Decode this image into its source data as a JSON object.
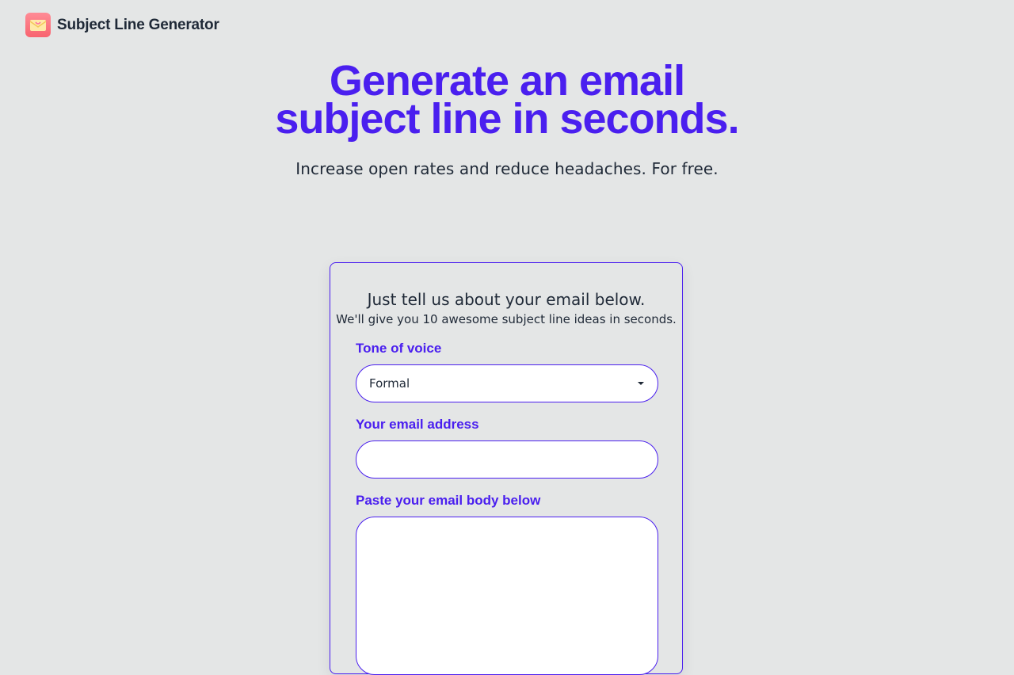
{
  "header": {
    "logo_icon": "envelope-icon",
    "brand_name": "Subject Line Generator"
  },
  "hero": {
    "title_line1": "Generate an email",
    "title_line2": "subject line in seconds.",
    "subtitle": "Increase open rates and reduce headaches. For free."
  },
  "form": {
    "heading": "Just tell us about your email below.",
    "subheading": "We'll give you 10 awesome subject line ideas in seconds.",
    "tone": {
      "label": "Tone of voice",
      "selected": "Formal",
      "caret_icon": "caret-down-icon"
    },
    "email": {
      "label": "Your email address",
      "value": "",
      "placeholder": ""
    },
    "body": {
      "label": "Paste your email body below",
      "value": "",
      "placeholder": ""
    }
  },
  "colors": {
    "accent": "#4a1fef",
    "background": "#e4e6e6",
    "text": "#1f2937",
    "logo": "#f8646f"
  }
}
